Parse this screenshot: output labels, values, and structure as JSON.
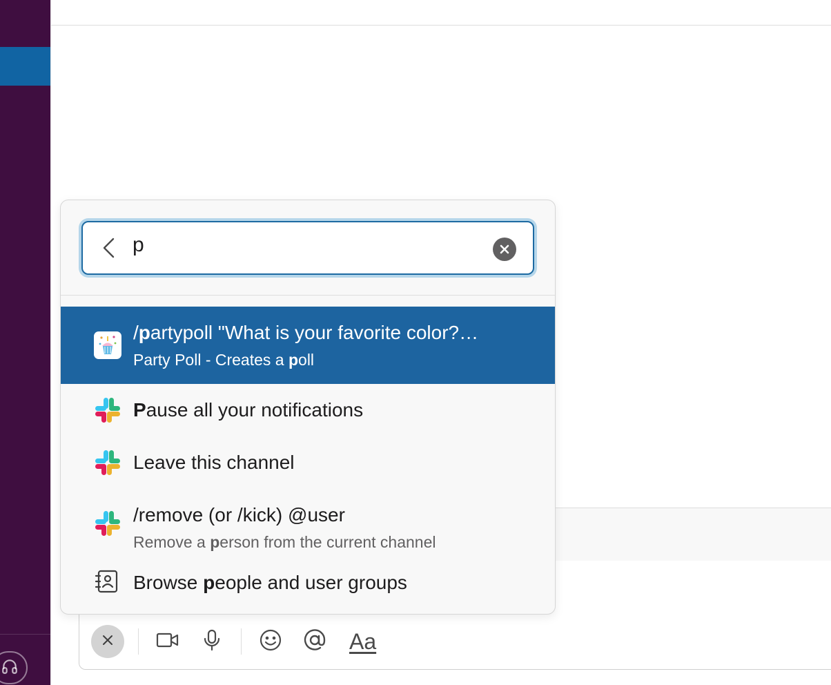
{
  "search": {
    "query": "p"
  },
  "results": [
    {
      "icon": "party-poll-app-icon",
      "title_pre": "/",
      "title_match": "p",
      "title_post": "artypoll \"What is your favorite color?…",
      "sub_pre": "Party Poll - Creates a ",
      "sub_match": "p",
      "sub_post": "oll"
    },
    {
      "icon": "slack-logo-icon",
      "title_match": "P",
      "title_post": "ause all your notifications"
    },
    {
      "icon": "slack-logo-icon",
      "title": "Leave this channel"
    },
    {
      "icon": "slack-logo-icon",
      "title": "/remove (or /kick) @user",
      "sub_pre": "Remove a ",
      "sub_match": "p",
      "sub_post": "erson from the current channel"
    },
    {
      "icon": "contacts-book-icon",
      "title_pre": "Browse ",
      "title_match": "p",
      "title_post": "eople and user groups"
    }
  ],
  "composer": {
    "format_label": "Aa"
  },
  "colors": {
    "sidebar": "#3f0e40",
    "sidebar_active": "#1164a3",
    "selected_row": "#1d64a0",
    "focus_ring": "#b5d6ea"
  }
}
